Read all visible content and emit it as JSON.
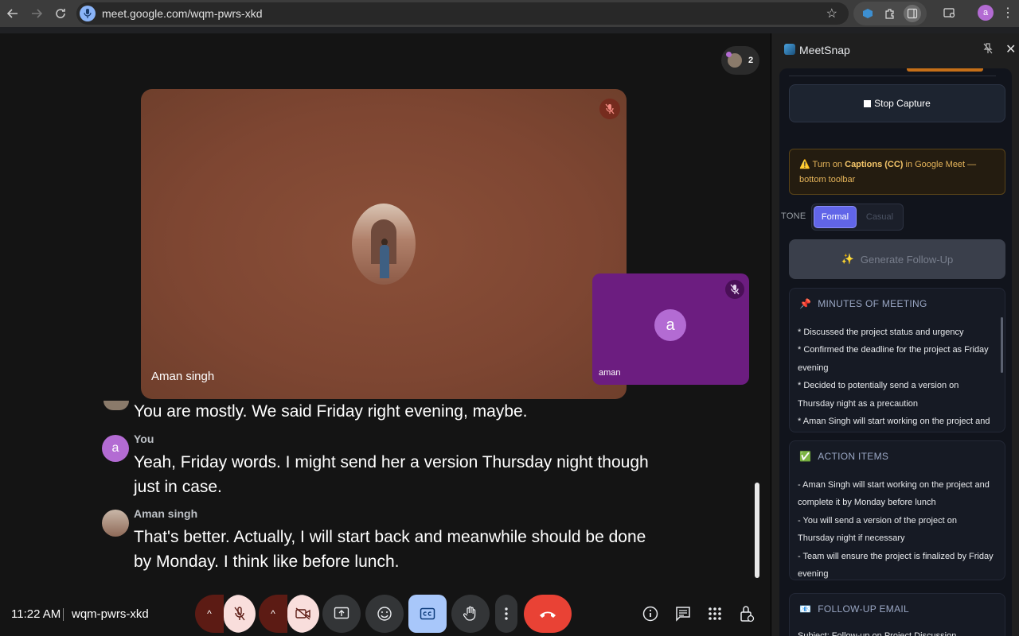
{
  "browser": {
    "url": "meet.google.com/wqm-pwrs-xkd",
    "profile_initial": "a"
  },
  "meet": {
    "participant_count": "2",
    "main_tile_name": "Aman singh",
    "self_tile_name": "aman",
    "self_initial": "a",
    "captions": {
      "partial_text": "You are mostly. We said Friday right evening, maybe.",
      "entries": [
        {
          "speaker": "You",
          "initial": "a",
          "text": "Yeah, Friday words. I might send her a version Thursday night though just in case."
        },
        {
          "speaker": "Aman singh",
          "initial": "",
          "text": "That's better. Actually, I will start back and meanwhile should be done by Monday. I think like before lunch."
        }
      ]
    },
    "clock": "11:22 AM",
    "meeting_code": "wqm-pwrs-xkd"
  },
  "panel": {
    "title": "MeetSnap",
    "stop_capture": "Stop Capture",
    "warning_pre": "⚠️ Turn on ",
    "warning_bold": "Captions (CC)",
    "warning_post": " in Google Meet — bottom toolbar",
    "tone_label": "TONE",
    "tone_options": [
      "Formal",
      "Casual"
    ],
    "tone_selected": "Formal",
    "generate_label": "Generate Follow-Up",
    "minutes": {
      "title": "MINUTES OF MEETING",
      "items": [
        "* Discussed the project status and urgency",
        "* Confirmed the deadline for the project as Friday evening",
        "* Decided to potentially send a version on Thursday night as a precaution",
        "* Aman Singh will start working on the project and"
      ]
    },
    "actions": {
      "title": "ACTION ITEMS",
      "items": [
        "- Aman Singh will start working on the project and complete it by Monday before lunch",
        "- You will send a version of the project on Thursday night if necessary",
        "- Team will ensure the project is finalized by Friday evening"
      ]
    },
    "email": {
      "title": "FOLLOW-UP EMAIL",
      "subject": "Subject: Follow-up on Project Discussion"
    }
  },
  "colors": {
    "accent": "#6165e8",
    "end_call": "#e94235",
    "self_tile": "#6c1d80",
    "captions_button": "#a8c7fa"
  }
}
